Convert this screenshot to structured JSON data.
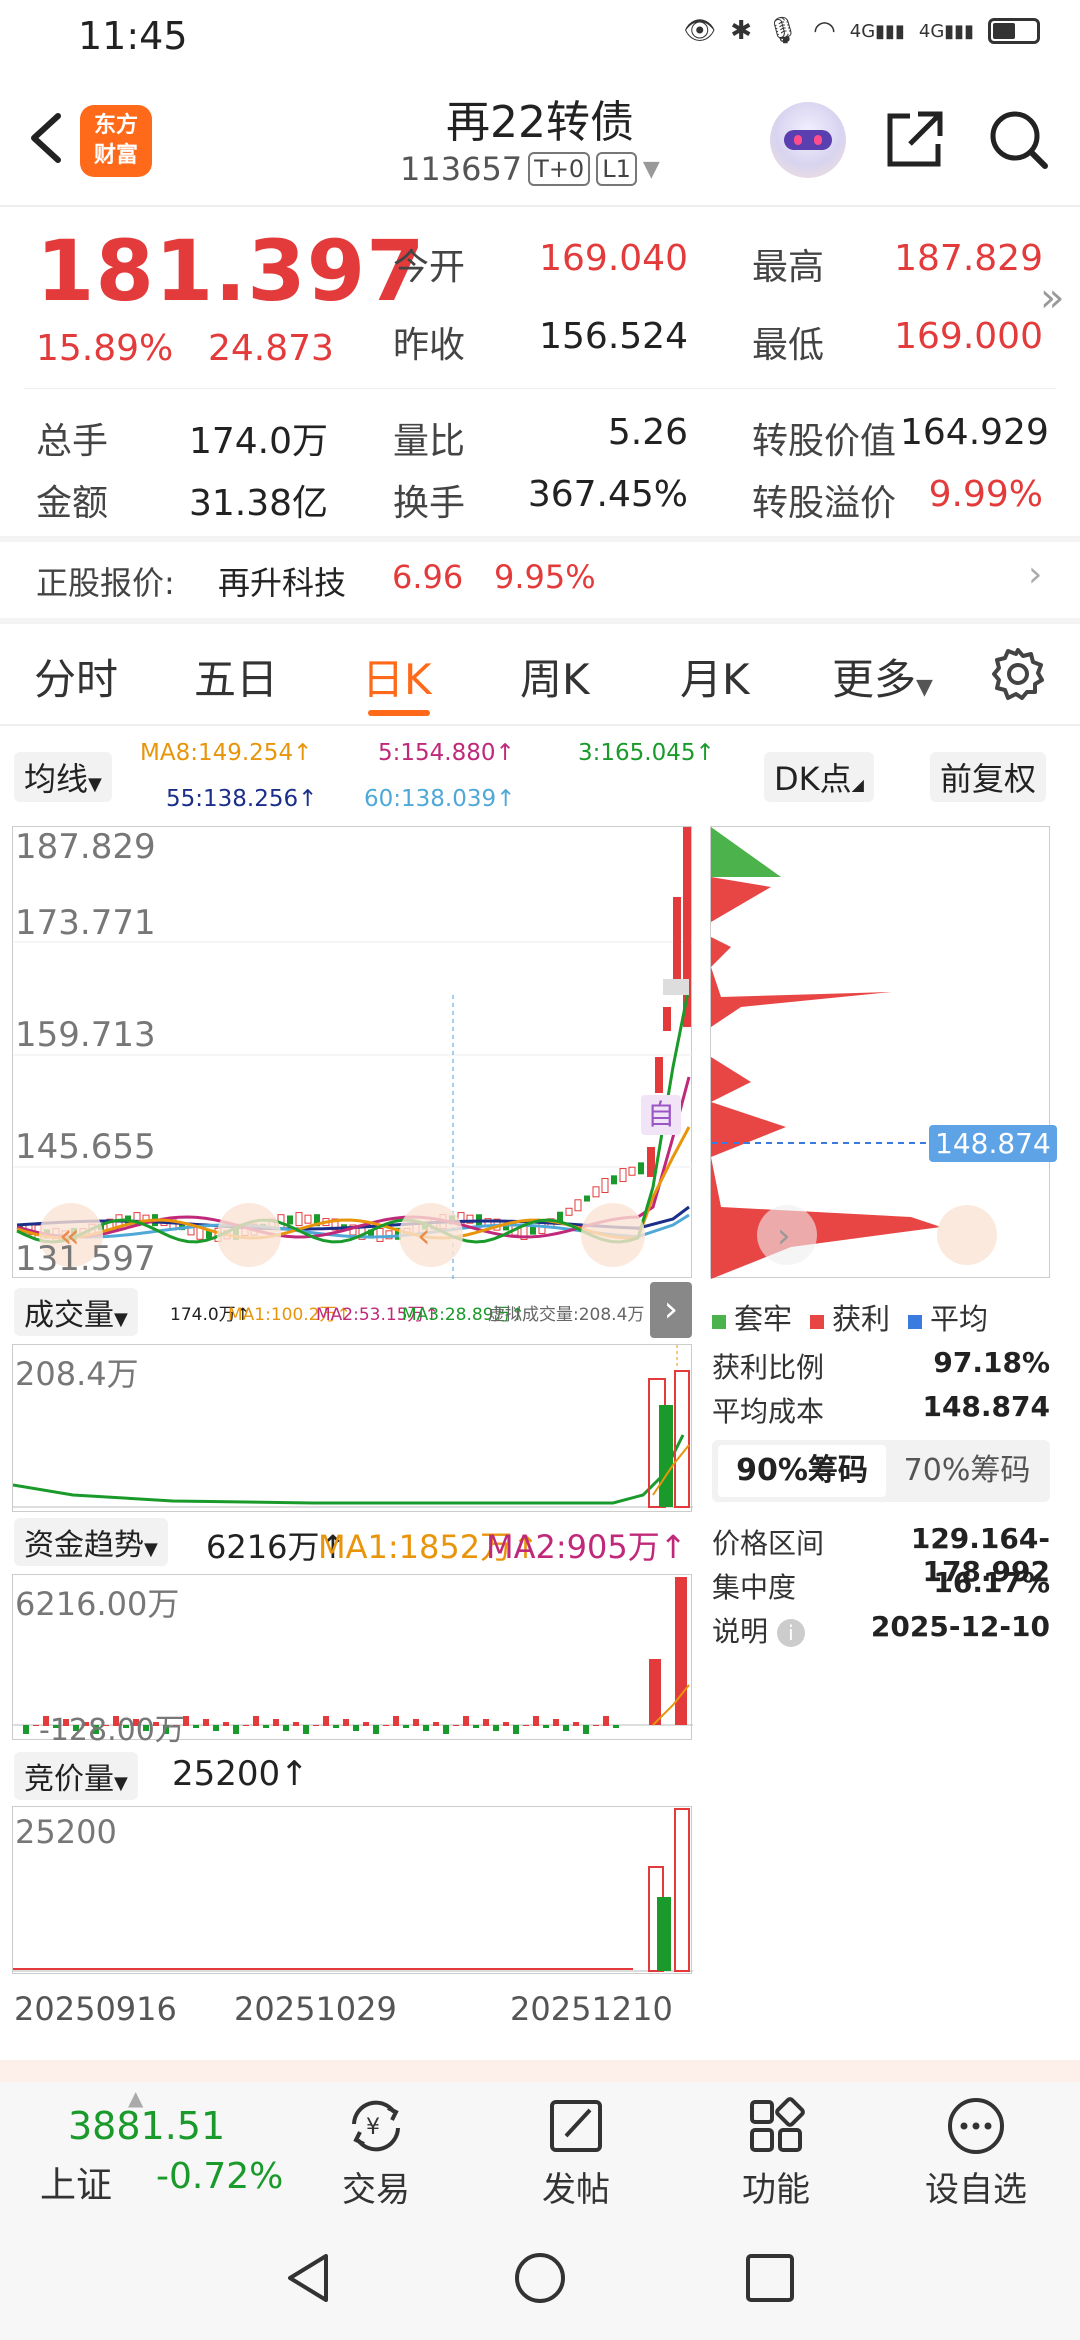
{
  "status": {
    "time": "11:45",
    "net1": "4G",
    "net2": "4G"
  },
  "header": {
    "brand_line1": "东方",
    "brand_line2": "财富",
    "title": "再22转债",
    "code": "113657",
    "tag1": "T+0",
    "tag2": "L1"
  },
  "quote": {
    "price": "181.397",
    "change_pct": "15.89%",
    "change_amt": "24.873",
    "open_label": "今开",
    "open": "169.040",
    "prev_label": "昨收",
    "prev": "156.524",
    "high_label": "最高",
    "high": "187.829",
    "low_label": "最低",
    "low": "169.000",
    "vol_label": "总手",
    "vol": "174.0万",
    "amount_label": "金额",
    "amount": "31.38亿",
    "ratio_label": "量比",
    "ratio": "5.26",
    "turnover_label": "换手",
    "turnover": "367.45%",
    "conv_value_label": "转股价值",
    "conv_value": "164.929",
    "premium_label": "转股溢价",
    "premium": "9.99%"
  },
  "underlying": {
    "label": "正股报价:",
    "name": "再升科技",
    "price": "6.96",
    "pct": "9.95%"
  },
  "tabs": [
    {
      "label": "分时"
    },
    {
      "label": "五日"
    },
    {
      "label": "日K"
    },
    {
      "label": "周K"
    },
    {
      "label": "月K"
    },
    {
      "label": "更多"
    }
  ],
  "ma_bar": {
    "selector": "均线",
    "ma8": "MA8:149.254↑",
    "ma5": "5:154.880↑",
    "ma3": "3:165.045↑",
    "ma55": "55:138.256↑",
    "ma60": "60:138.039↑",
    "dk_btn": "DK点",
    "fq_btn": "前复权"
  },
  "kline": {
    "y_labels": [
      "187.829",
      "173.771",
      "159.713",
      "145.655",
      "131.597"
    ],
    "marker": "自"
  },
  "volume": {
    "selector": "成交量",
    "v": "174.0万↑",
    "ma1": "MA1:100.2万↑",
    "ma2": "MA2:53.15万↑",
    "ma3": "MA3:28.89万↑",
    "virt": "虚拟成交量:208.4万",
    "y_top": "208.4万"
  },
  "fund": {
    "selector": "资金趋势",
    "v": "6216万↑",
    "ma1": "MA1:1852万↑",
    "ma2": "MA2:905万↑",
    "y_top": "6216.00万",
    "y_bottom": "-128.00万"
  },
  "auction": {
    "selector": "竞价量",
    "v": "25200↑",
    "y_top": "25200"
  },
  "dates": [
    "20250916",
    "20251029",
    "20251210"
  ],
  "chips": {
    "price_mark": "148.874",
    "legend": [
      "套牢",
      "获利",
      "平均"
    ],
    "profit_ratio_label": "获利比例",
    "profit_ratio": "97.18%",
    "avg_cost_label": "平均成本",
    "avg_cost": "148.874",
    "tab90": "90%筹码",
    "tab70": "70%筹码",
    "range_label": "价格区间",
    "range": "129.164-178.992",
    "conc_label": "集中度",
    "conc": "16.17%",
    "note_label": "说明",
    "note_date": "2025-12-10",
    "colors": {
      "trapped": "#4cb34c",
      "profit": "#e84545",
      "avg": "#3a7be0"
    }
  },
  "bottom": {
    "index_val": "3881.51",
    "index_name": "上证",
    "index_pct": "-0.72%",
    "nav": [
      "交易",
      "发帖",
      "功能",
      "设自选"
    ]
  }
}
